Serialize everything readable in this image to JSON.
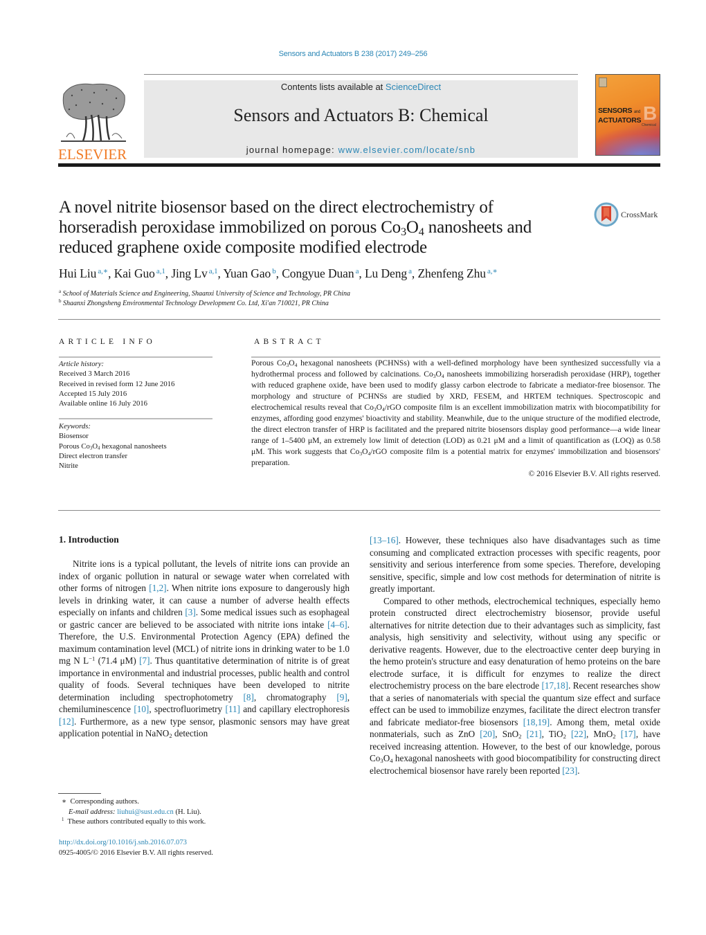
{
  "header": {
    "journal_ref": "Sensors and Actuators B 238 (2017) 249–256",
    "contents_prefix": "Contents lists available at ",
    "contents_link": "ScienceDirect",
    "journal_title": "Sensors and Actuators B: Chemical",
    "homepage_prefix": "journal homepage: ",
    "homepage_link": "www.elsevier.com/locate/snb",
    "publisher_logo_text": "ELSEVIER",
    "cover": {
      "line1": "SENSORS",
      "and": "and",
      "line2": "ACTUATORS",
      "letter": "B",
      "sub": "Chemical"
    },
    "colors": {
      "link": "#2a86b5",
      "elsevier_orange": "#f07a24",
      "banner_bg": "#e8e8e8"
    }
  },
  "article": {
    "title_parts": {
      "line1": "A novel nitrite biosensor based on the direct electrochemistry of",
      "line2_pre": "horseradish peroxidase immobilized on porous Co",
      "line2_sub1": "3",
      "line2_mid": "O",
      "line2_sub2": "4",
      "line2_post": " nanosheets and",
      "line3": "reduced graphene oxide composite modified electrode"
    },
    "crossmark_label": "CrossMark",
    "authors": [
      {
        "name": "Hui Liu",
        "marks": "a,∗"
      },
      {
        "name": "Kai Guo",
        "marks": "a,1"
      },
      {
        "name": "Jing Lv",
        "marks": "a,1"
      },
      {
        "name": "Yuan Gao",
        "marks": "b"
      },
      {
        "name": "Congyue Duan",
        "marks": "a"
      },
      {
        "name": "Lu Deng",
        "marks": "a"
      },
      {
        "name": "Zhenfeng Zhu",
        "marks": "a,∗"
      }
    ],
    "affiliations": [
      {
        "mark": "a",
        "text": "School of Materials Science and Engineering, Shaanxi University of Science and Technology, PR China"
      },
      {
        "mark": "b",
        "text": "Shaanxi Zhongsheng Environmental Technology Development Co. Ltd, Xi'an 710021, PR China"
      }
    ]
  },
  "article_info": {
    "heading": "ARTICLE INFO",
    "history_label": "Article history:",
    "history": [
      "Received 3 March 2016",
      "Received in revised form 12 June 2016",
      "Accepted 15 July 2016",
      "Available online 16 July 2016"
    ],
    "keywords_label": "Keywords:",
    "keywords": [
      "Biosensor",
      "Porous Co3O4 hexagonal nanosheets",
      "Direct electron transfer",
      "Nitrite"
    ]
  },
  "abstract": {
    "heading": "ABSTRACT",
    "text": "Porous Co₃O₄ hexagonal nanosheets (PCHNSs) with a well-defined morphology have been synthesized successfully via a hydrothermal process and followed by calcinations. Co₃O₄ nanosheets immobilizing horseradish peroxidase (HRP), together with reduced graphene oxide, have been used to modify glassy carbon electrode to fabricate a mediator-free biosensor. The morphology and structure of PCHNSs are studied by XRD, FESEM, and HRTEM techniques. Spectroscopic and electrochemical results reveal that Co₃O₄/rGO composite film is an excellent immobilization matrix with biocompatibility for enzymes, affording good enzymes' bioactivity and stability. Meanwhile, due to the unique structure of the modified electrode, the direct electron transfer of HRP is facilitated and the prepared nitrite biosensors display good performance—a wide linear range of 1–5400 μM, an extremely low limit of detection (LOD) as 0.21 μM and a limit of quantification as (LOQ) as 0.58 μM. This work suggests that Co₃O₄/rGO composite film is a potential matrix for enzymes' immobilization and biosensors' preparation.",
    "copyright": "© 2016 Elsevier B.V. All rights reserved."
  },
  "introduction": {
    "heading": "1.  Introduction",
    "left_paragraph": [
      {
        "t": "Nitrite ions is a typical pollutant, the levels of nitrite ions can provide an index of organic pollution in natural or sewage water when correlated with other forms of nitrogen "
      },
      {
        "ref": "[1,2]"
      },
      {
        "t": ". When nitrite ions exposure to dangerously high levels in drinking water, it can cause a number of adverse health effects especially on infants and children "
      },
      {
        "ref": "[3]"
      },
      {
        "t": ". Some medical issues such as esophageal or gastric cancer are believed to be associated with nitrite ions intake "
      },
      {
        "ref": "[4–6]"
      },
      {
        "t": ". Therefore, the U.S. Environmental Protection Agency (EPA) defined the maximum contamination level (MCL) of nitrite ions in drinking water to be 1.0 mg N L⁻¹ (71.4 μM) "
      },
      {
        "ref": "[7]"
      },
      {
        "t": ". Thus quantitative determination of nitrite is of great importance in environmental and industrial processes, public health and control quality of foods. Several techniques have been developed to nitrite determination including spectrophotometry "
      },
      {
        "ref": "[8]"
      },
      {
        "t": ", chromatography "
      },
      {
        "ref": "[9]"
      },
      {
        "t": ", chemiluminescence "
      },
      {
        "ref": "[10]"
      },
      {
        "t": ", spectrofluorimetry "
      },
      {
        "ref": "[11]"
      },
      {
        "t": " and capillary electrophoresis "
      },
      {
        "ref": "[12]"
      },
      {
        "t": ". Furthermore, as a new type sensor, plasmonic sensors may have great application potential in NaNO₂ detection"
      }
    ],
    "right_paragraph_1": [
      {
        "ref": "[13–16]"
      },
      {
        "t": ". However, these techniques also have disadvantages such as time consuming and complicated extraction processes with specific reagents, poor sensitivity and serious interference from some species. Therefore, developing sensitive, specific, simple and low cost methods for determination of nitrite is greatly important."
      }
    ],
    "right_paragraph_2": [
      {
        "t": "Compared to other methods, electrochemical techniques, especially hemo protein constructed direct electrochemistry biosensor, provide useful alternatives for nitrite detection due to their advantages such as simplicity, fast analysis, high sensitivity and selectivity, without using any specific or derivative reagents. However, due to the electroactive center deep burying in the hemo protein's structure and easy denaturation of hemo proteins on the bare electrode surface, it is difficult for enzymes to realize the direct electrochemistry process on the bare electrode "
      },
      {
        "ref": "[17,18]"
      },
      {
        "t": ". Recent researches show that a series of nanomaterials with special the quantum size effect and surface effect can be used to immobilize enzymes, facilitate the direct electron transfer and fabricate mediator-free biosensors "
      },
      {
        "ref": "[18,19]"
      },
      {
        "t": ". Among them, metal oxide nonmaterials, such as ZnO "
      },
      {
        "ref": "[20]"
      },
      {
        "t": ", SnO₂ "
      },
      {
        "ref": "[21]"
      },
      {
        "t": ", TiO₂ "
      },
      {
        "ref": "[22]"
      },
      {
        "t": ", MnO₂ "
      },
      {
        "ref": "[17]"
      },
      {
        "t": ", have received increasing attention. However, to the best of our knowledge, porous Co₃O₄ hexagonal nanosheets with good biocompatibility for constructing direct electrochemical biosensor have rarely been reported "
      },
      {
        "ref": "[23]"
      },
      {
        "t": "."
      }
    ]
  },
  "footnotes": {
    "corresponding": "Corresponding authors.",
    "email_label": "E-mail address: ",
    "email": "liuhui@sust.edu.cn",
    "email_suffix": " (H. Liu).",
    "equal_contrib": "These authors contributed equally to this work.",
    "doi": "http://dx.doi.org/10.1016/j.snb.2016.07.073",
    "issn_copyright": "0925-4005/© 2016 Elsevier B.V. All rights reserved."
  }
}
